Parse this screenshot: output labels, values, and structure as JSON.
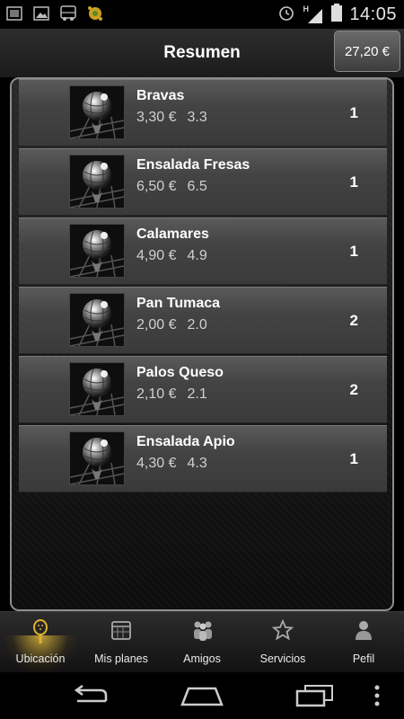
{
  "status_bar": {
    "time": "14:05",
    "network_label": "H",
    "left_icons": [
      "3g-icon",
      "image-icon",
      "bus-icon",
      "gear-icon"
    ],
    "right_icons": [
      "alarm-icon",
      "signal-icon",
      "battery-icon"
    ]
  },
  "header": {
    "title": "Resumen",
    "total": "27,20 €"
  },
  "items": [
    {
      "name": "Bravas",
      "price": "3,30 €",
      "value": "3.3",
      "qty": "1"
    },
    {
      "name": "Ensalada Fresas",
      "price": "6,50 €",
      "value": "6.5",
      "qty": "1"
    },
    {
      "name": "Calamares",
      "price": "4,90 €",
      "value": "4.9",
      "qty": "1"
    },
    {
      "name": "Pan Tumaca",
      "price": "2,00 €",
      "value": "2.0",
      "qty": "2"
    },
    {
      "name": "Palos Queso",
      "price": "2,10 €",
      "value": "2.1",
      "qty": "2"
    },
    {
      "name": "Ensalada Apio",
      "price": "4,30 €",
      "value": "4.3",
      "qty": "1"
    }
  ],
  "tabs": [
    {
      "label": "Ubicación",
      "icon": "padel-racket-icon",
      "active": true
    },
    {
      "label": "Mis planes",
      "icon": "calendar-icon",
      "active": false
    },
    {
      "label": "Amigos",
      "icon": "people-icon",
      "active": false
    },
    {
      "label": "Servicios",
      "icon": "star-icon",
      "active": false
    },
    {
      "label": "Pefil",
      "icon": "person-icon",
      "active": false
    }
  ],
  "nav": [
    "back-icon",
    "home-icon",
    "recent-apps-icon",
    "overflow-menu-icon"
  ]
}
